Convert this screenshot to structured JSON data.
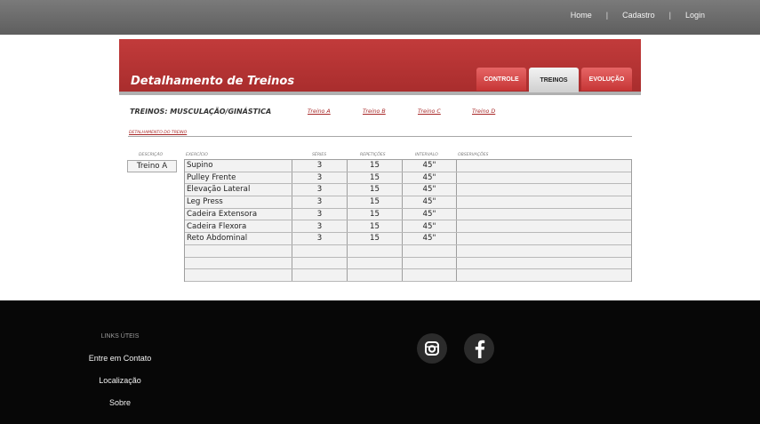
{
  "nav": {
    "home": "Home",
    "sep1": "|",
    "cadastro": "Cadastro",
    "sep2": "|",
    "login": "Login"
  },
  "header": {
    "title": "Detalhamento de Treinos"
  },
  "tabs": [
    {
      "label": "CONTROLE"
    },
    {
      "label": "TREINOS"
    },
    {
      "label": "EVOLUÇÃO"
    }
  ],
  "section": {
    "title": "TREINOS: MUSCULAÇÃO/GINÁSTICA",
    "links": [
      "Treino A",
      "Treino B",
      "Treino C",
      "Treino D"
    ],
    "subtitle": "DETALHAMENTO DO TREINO"
  },
  "columns": {
    "descricao": "DESCRIÇÃO",
    "exercicio": "EXERCÍCIO",
    "series": "SÉRIES",
    "repeticoes": "REPETIÇÕES",
    "intervalo": "INTERVALO",
    "observacoes": "OBSERVAÇÕES"
  },
  "descricao_value": "Treino A",
  "rows": [
    {
      "exercicio": "Supino",
      "series": "3",
      "repeticoes": "15",
      "intervalo": "45\"",
      "obs": ""
    },
    {
      "exercicio": "Pulley Frente",
      "series": "3",
      "repeticoes": "15",
      "intervalo": "45\"",
      "obs": ""
    },
    {
      "exercicio": "Elevação Lateral",
      "series": "3",
      "repeticoes": "15",
      "intervalo": "45\"",
      "obs": ""
    },
    {
      "exercicio": "Leg Press",
      "series": "3",
      "repeticoes": "15",
      "intervalo": "45\"",
      "obs": ""
    },
    {
      "exercicio": "Cadeira Extensora",
      "series": "3",
      "repeticoes": "15",
      "intervalo": "45\"",
      "obs": ""
    },
    {
      "exercicio": "Cadeira Flexora",
      "series": "3",
      "repeticoes": "15",
      "intervalo": "45\"",
      "obs": ""
    },
    {
      "exercicio": "Reto Abdominal",
      "series": "3",
      "repeticoes": "15",
      "intervalo": "45\"",
      "obs": ""
    },
    {
      "exercicio": "",
      "series": "",
      "repeticoes": "",
      "intervalo": "",
      "obs": ""
    },
    {
      "exercicio": "",
      "series": "",
      "repeticoes": "",
      "intervalo": "",
      "obs": ""
    },
    {
      "exercicio": "",
      "series": "",
      "repeticoes": "",
      "intervalo": "",
      "obs": ""
    }
  ],
  "footer": {
    "heading": "LINKS ÚTEIS",
    "links": [
      "Entre em Contato",
      "Localização",
      "Sobre"
    ],
    "social": [
      "instagram-icon",
      "facebook-icon"
    ]
  },
  "colors": {
    "brand_red": "#b83232",
    "tab_red": "#d94848",
    "footer_bg": "#070707"
  }
}
